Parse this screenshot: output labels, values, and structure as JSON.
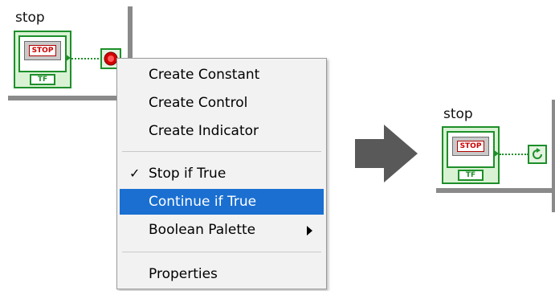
{
  "left_diagram": {
    "label": "stop",
    "stop_button_text": "STOP",
    "tf_text": "TF"
  },
  "context_menu": {
    "items": [
      {
        "label": "Create Constant"
      },
      {
        "label": "Create Control"
      },
      {
        "label": "Create Indicator"
      },
      {
        "label": "Stop if True",
        "checked": true,
        "check_glyph": "✓"
      },
      {
        "label": "Continue if True",
        "highlighted": true
      },
      {
        "label": "Boolean Palette",
        "has_submenu": true
      },
      {
        "label": "Properties"
      }
    ]
  },
  "arrow": {
    "icon": "right-arrow-icon",
    "color": "#595959"
  },
  "right_diagram": {
    "label": "stop",
    "stop_button_text": "STOP",
    "tf_text": "TF"
  },
  "colors": {
    "terminal_green": "#1e8f2a",
    "highlight_blue": "#1a6fd1",
    "loop_gray": "#8a8a8a",
    "stop_red": "#cc0000"
  }
}
